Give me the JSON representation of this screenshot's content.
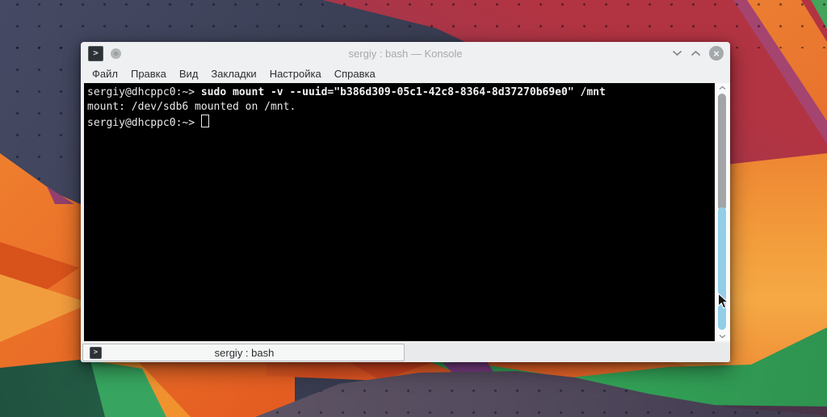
{
  "colors": {
    "accent_blue": "#93cee9",
    "titlebar_bg": "#eff0f1",
    "terminal_bg": "#000000",
    "terminal_fg": "#e9e9e9"
  },
  "window": {
    "title": "sergiy : bash — Konsole",
    "app_icon_glyph": ">",
    "close_glyph": "×"
  },
  "menubar": {
    "items": [
      "Файл",
      "Правка",
      "Вид",
      "Закладки",
      "Настройка",
      "Справка"
    ]
  },
  "terminal": {
    "lines": [
      {
        "prompt": "sergiy@dhcppc0:~> ",
        "command": "sudo mount -v --uuid=\"b386d309-05c1-42c8-8364-8d37270b69e0\" /mnt"
      },
      {
        "text": "mount: /dev/sdb6 mounted on /mnt."
      },
      {
        "prompt": "sergiy@dhcppc0:~> "
      }
    ]
  },
  "tabbar": {
    "tab_label": "sergiy : bash",
    "tab_icon_glyph": ">"
  }
}
